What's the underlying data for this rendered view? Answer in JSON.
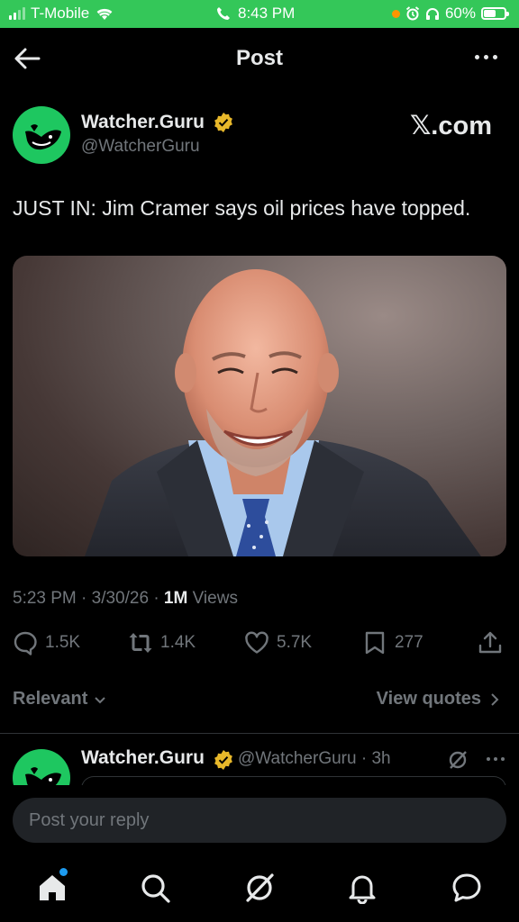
{
  "status_bar": {
    "carrier": "T-Mobile",
    "time": "8:43 PM",
    "battery": "60%",
    "battery_level": 0.6
  },
  "header": {
    "title": "Post"
  },
  "post": {
    "author_name": "Watcher.Guru",
    "author_handle": "@WatcherGuru",
    "source_label": "𝕏.com",
    "text": "JUST IN: Jim Cramer says oil prices have topped.",
    "timestamp": "5:23 PM · 3/30/26 · ",
    "views_count": "1M",
    "views_label": " Views",
    "replies": "1.5K",
    "reposts": "1.4K",
    "likes": "5.7K",
    "bookmarks": "277"
  },
  "replies_bar": {
    "sort_label": "Relevant",
    "quotes_label": "View quotes"
  },
  "reply_preview": {
    "author_name": "Watcher.Guru",
    "handle_time": "@WatcherGuru · 3h"
  },
  "composer": {
    "placeholder": "Post your reply"
  },
  "colors": {
    "accent": "#1d9bf0",
    "verified_gold": "#e8b82a",
    "brand_green": "#1ec760",
    "status_green": "#34c759"
  },
  "icons": [
    "back-arrow-icon",
    "more-icon",
    "verified-badge-icon",
    "reply-icon",
    "repost-icon",
    "like-icon",
    "bookmark-icon",
    "share-icon",
    "grok-icon",
    "home-icon",
    "search-icon",
    "bell-icon",
    "messages-icon"
  ]
}
